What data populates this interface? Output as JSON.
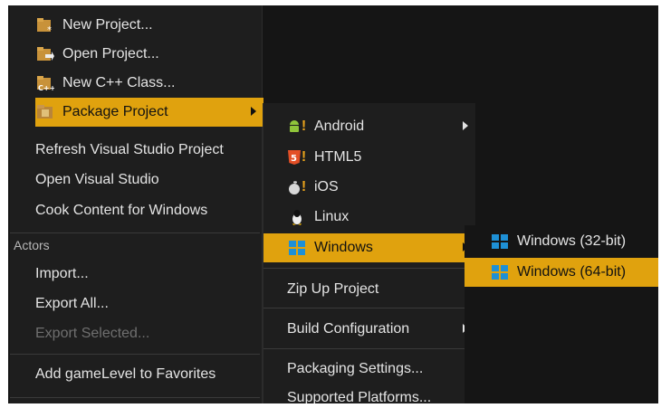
{
  "file_menu": {
    "items": [
      {
        "label": "New Project...",
        "icon": "new-project-icon"
      },
      {
        "label": "Open Project...",
        "icon": "open-project-icon"
      },
      {
        "label": "New C++ Class...",
        "icon": "cpp-class-icon"
      },
      {
        "label": "Package Project",
        "icon": "package-icon",
        "submenu": true,
        "selected": true
      },
      {
        "label": "Refresh Visual Studio Project"
      },
      {
        "label": "Open Visual Studio"
      },
      {
        "label": "Cook Content for Windows"
      }
    ],
    "actors_header": "Actors",
    "actors_items": [
      {
        "label": "Import..."
      },
      {
        "label": "Export All..."
      },
      {
        "label": "Export Selected...",
        "disabled": true
      }
    ],
    "favorites": "Add gameLevel to Favorites"
  },
  "package_menu": {
    "platforms": [
      {
        "label": "Android",
        "icon": "android-icon",
        "submenu": true
      },
      {
        "label": "HTML5",
        "icon": "html5-icon"
      },
      {
        "label": "iOS",
        "icon": "apple-icon"
      },
      {
        "label": "Linux",
        "icon": "linux-icon"
      },
      {
        "label": "Windows",
        "icon": "windows-icon",
        "submenu": true,
        "selected": true
      }
    ],
    "zip": "Zip Up Project",
    "build_config": "Build Configuration",
    "packaging_settings": "Packaging Settings...",
    "supported_platforms": "Supported Platforms..."
  },
  "windows_menu": {
    "items": [
      {
        "label": "Windows (32-bit)",
        "icon": "windows-icon"
      },
      {
        "label": "Windows (64-bit)",
        "icon": "windows-icon",
        "selected": true
      }
    ]
  },
  "colors": {
    "highlight": "#e0a20e",
    "menu_bg": "#1e1e1e",
    "text": "#e4e4e4",
    "disabled_text": "#6f6f6f"
  },
  "icon_marks": {
    "warning_mark": "!"
  }
}
